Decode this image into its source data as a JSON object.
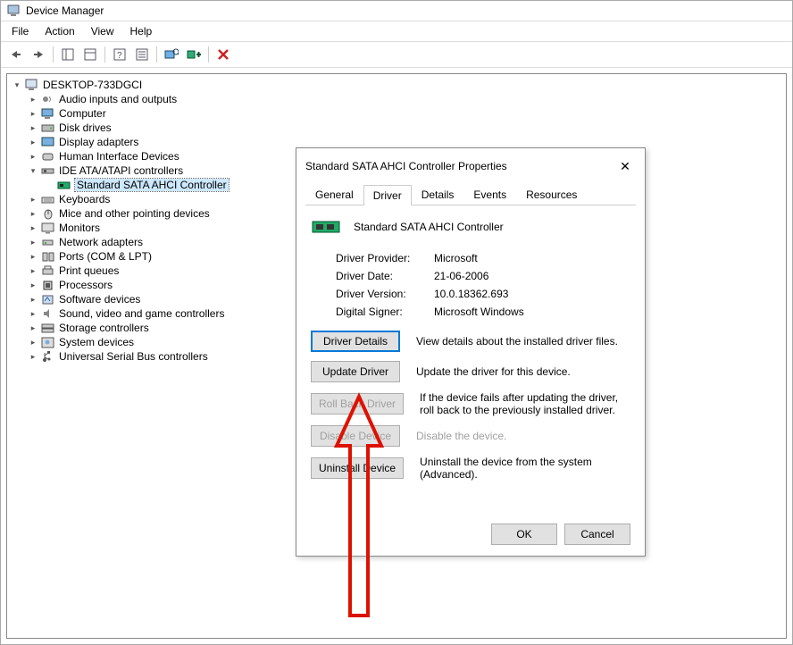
{
  "window": {
    "title": "Device Manager"
  },
  "menu": {
    "file": "File",
    "action": "Action",
    "view": "View",
    "help": "Help"
  },
  "tree": {
    "root": "DESKTOP-733DGCI",
    "nodes": [
      {
        "label": "Audio inputs and outputs"
      },
      {
        "label": "Computer"
      },
      {
        "label": "Disk drives"
      },
      {
        "label": "Display adapters"
      },
      {
        "label": "Human Interface Devices"
      },
      {
        "label": "IDE ATA/ATAPI controllers",
        "expanded": true,
        "children": [
          {
            "label": "Standard SATA AHCI Controller",
            "selected": true
          }
        ]
      },
      {
        "label": "Keyboards"
      },
      {
        "label": "Mice and other pointing devices"
      },
      {
        "label": "Monitors"
      },
      {
        "label": "Network adapters"
      },
      {
        "label": "Ports (COM & LPT)"
      },
      {
        "label": "Print queues"
      },
      {
        "label": "Processors"
      },
      {
        "label": "Software devices"
      },
      {
        "label": "Sound, video and game controllers"
      },
      {
        "label": "Storage controllers"
      },
      {
        "label": "System devices"
      },
      {
        "label": "Universal Serial Bus controllers"
      }
    ]
  },
  "dialog": {
    "title": "Standard SATA AHCI Controller Properties",
    "tabs": {
      "general": "General",
      "driver": "Driver",
      "details": "Details",
      "events": "Events",
      "resources": "Resources"
    },
    "deviceName": "Standard SATA AHCI Controller",
    "info": {
      "providerLabel": "Driver Provider:",
      "providerValue": "Microsoft",
      "dateLabel": "Driver Date:",
      "dateValue": "21-06-2006",
      "versionLabel": "Driver Version:",
      "versionValue": "10.0.18362.693",
      "signerLabel": "Digital Signer:",
      "signerValue": "Microsoft Windows"
    },
    "actions": {
      "driverDetails": {
        "label": "Driver Details",
        "desc": "View details about the installed driver files."
      },
      "updateDriver": {
        "label": "Update Driver",
        "desc": "Update the driver for this device."
      },
      "rollBack": {
        "label": "Roll Back Driver",
        "desc": "If the device fails after updating the driver, roll back to the previously installed driver."
      },
      "disable": {
        "label": "Disable Device",
        "desc": "Disable the device."
      },
      "uninstall": {
        "label": "Uninstall Device",
        "desc": "Uninstall the device from the system (Advanced)."
      }
    },
    "buttons": {
      "ok": "OK",
      "cancel": "Cancel"
    }
  }
}
